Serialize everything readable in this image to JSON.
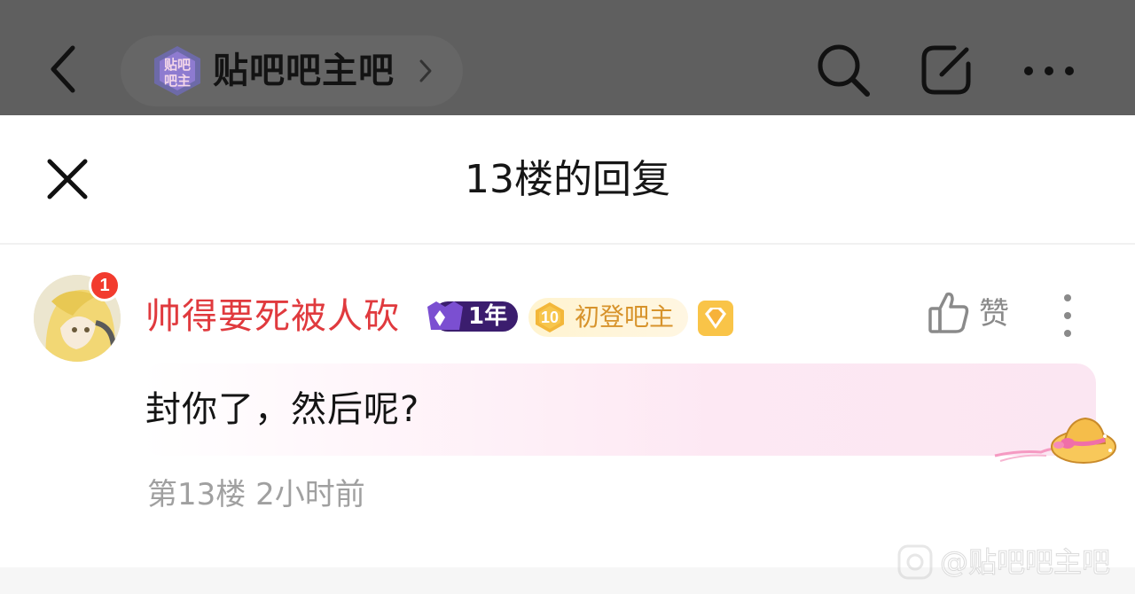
{
  "topbar": {
    "forum_logo_text": "贴吧吧主",
    "forum_name": "贴吧吧主吧",
    "icons": {
      "back": "chevron-left-icon",
      "forum_chevron": "chevron-right-icon",
      "search": "search-icon",
      "edit": "edit-icon",
      "more": "more-horizontal-icon"
    }
  },
  "sheet": {
    "title": "13楼的回复",
    "close_icon": "close-icon"
  },
  "reply": {
    "notification_count": "1",
    "username": "帅得要死被人砍",
    "badges": {
      "year": "1年",
      "level_number": "10",
      "level_title": "初登吧主",
      "vip_icon": "diamond-badge-icon"
    },
    "like_label": "赞",
    "content": "封你了，然后呢?",
    "meta": "第13楼 2小时前"
  },
  "watermark": "@贴吧吧主吧",
  "colors": {
    "topbar_bg": "#5f5f5f",
    "username": "#e03a3e",
    "meta_text": "#a0a0a0",
    "badge_purple": "#5b2aa0",
    "badge_gold": "#f5b73b",
    "notification_red": "#f23b2e"
  }
}
